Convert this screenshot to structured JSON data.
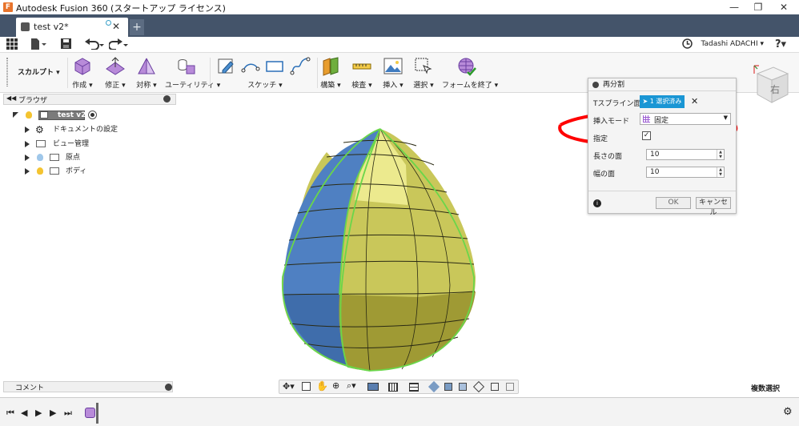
{
  "window": {
    "title": "Autodesk Fusion 360 (スタートアップ ライセンス)",
    "logo_letter": "F",
    "minimize": "—",
    "maximize": "❐",
    "close": "✕"
  },
  "tabs": {
    "active_label": "test v2*",
    "close": "✕",
    "new_tab": "+"
  },
  "quickbar": {
    "user": "Tadashi ADACHI ▾",
    "help": "?▾"
  },
  "ribbon": {
    "workspace": "スカルプト ▾",
    "groups": {
      "create": "作成 ▾",
      "modify": "修正 ▾",
      "symmetry": "対称 ▾",
      "utility": "ユーティリティ ▾",
      "sketch": "スケッチ ▾",
      "construct": "構築 ▾",
      "inspect": "検査 ▾",
      "insert": "挿入 ▾",
      "select": "選択 ▾",
      "finish": "フォームを終了 ▾"
    }
  },
  "browser": {
    "header": "ブラウザ",
    "root": "test v2",
    "items": [
      "ドキュメントの設定",
      "ビュー管理",
      "原点",
      "ボディ"
    ]
  },
  "comments": {
    "label": "コメント"
  },
  "viewcube": {
    "face": "右"
  },
  "dialog": {
    "title": "再分割",
    "tspline_label": "Tスプライン面",
    "select_button": "1 選択済み",
    "insert_mode_label": "挿入モード",
    "insert_mode_value": "固定",
    "specify_label": "指定",
    "specify_checked": true,
    "length_faces_label": "長さの面",
    "length_faces_value": "10",
    "width_faces_label": "幅の面",
    "width_faces_value": "10",
    "ok": "OK",
    "cancel": "キャンセル"
  },
  "status": {
    "multi_select": "複数選択"
  },
  "colors": {
    "egg_yellow": "#c9c75a",
    "egg_dark": "#9f9a34",
    "egg_highlight": "#ecea8e",
    "egg_blue": "#4f80c2",
    "egg_edge": "#6ad64a",
    "annotation": "#ff0000",
    "tab_bar": "#44546a",
    "select_button": "#1a96d4"
  }
}
